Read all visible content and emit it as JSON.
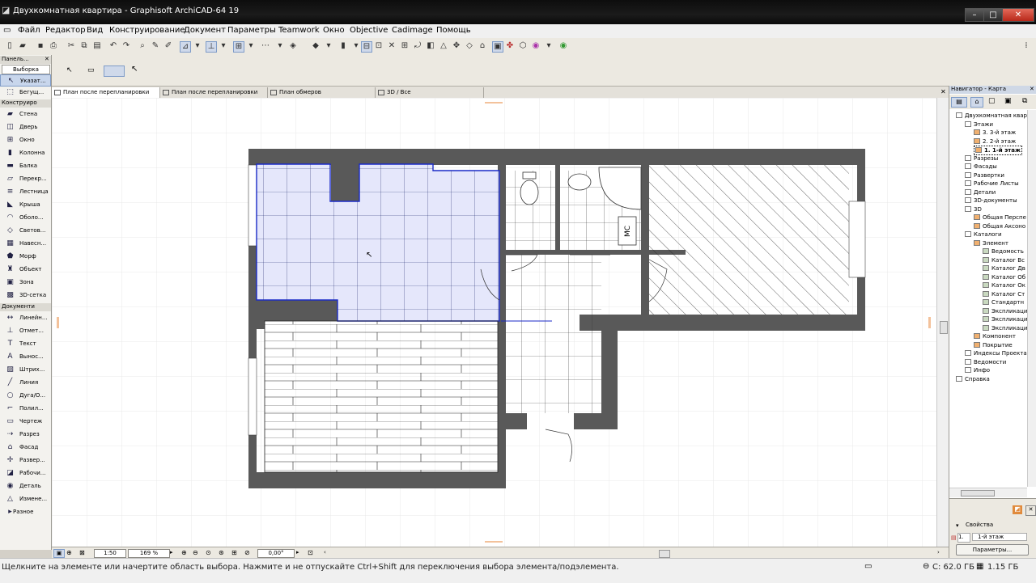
{
  "window": {
    "title": "Двухкомнатная квартира - Graphisoft ArchiCAD-64 19",
    "buttons": [
      "–",
      "□",
      "✕"
    ]
  },
  "menu": [
    "Файл",
    "Редактор",
    "Вид",
    "Конструирование",
    "Документ",
    "Параметры",
    "Teamwork",
    "Окно",
    "Objective",
    "Cadimage",
    "Помощь"
  ],
  "left_panel": {
    "header": "Панель...",
    "tab": "Выборка",
    "pointer": "Указат...",
    "marquee": "Бегущ...",
    "section_design": "Конструиро",
    "design_tools": [
      "Стена",
      "Дверь",
      "Окно",
      "Колонна",
      "Балка",
      "Перекр...",
      "Лестница",
      "Крыша",
      "Оболо...",
      "Светов...",
      "Навесн...",
      "Морф",
      "Объект",
      "Зона",
      "3D-сетка"
    ],
    "section_document": "Документи",
    "document_tools": [
      "Линейн...",
      "Отмет...",
      "Текст",
      "Вынос...",
      "Штрих...",
      "Линия",
      "Дуга/О...",
      "Полил...",
      "Чертеж",
      "Разрез",
      "Фасад",
      "Развер...",
      "Рабочи...",
      "Деталь",
      "Измене..."
    ],
    "section_misc": "Разное"
  },
  "tabs": [
    "План после перепланировки",
    "План после перепланировки",
    "План обмеров",
    "3D / Все"
  ],
  "drawing": {
    "label_wc": "МС"
  },
  "navigator": {
    "header": "Навигатор - Карта",
    "tree": [
      {
        "label": "Двухкомнатная кварти",
        "level": 0
      },
      {
        "label": "Этажи",
        "level": 1
      },
      {
        "label": "3. 3-й этаж",
        "level": 2
      },
      {
        "label": "2. 2-й этаж",
        "level": 2
      },
      {
        "label": "1. 1-й этаж",
        "level": 2,
        "selected": true
      },
      {
        "label": "Разрезы",
        "level": 1
      },
      {
        "label": "Фасады",
        "level": 1
      },
      {
        "label": "Развертки",
        "level": 1
      },
      {
        "label": "Рабочие Листы",
        "level": 1
      },
      {
        "label": "Детали",
        "level": 1
      },
      {
        "label": "3D-документы",
        "level": 1
      },
      {
        "label": "3D",
        "level": 1
      },
      {
        "label": "Общая Перспе",
        "level": 2
      },
      {
        "label": "Общая Аксоно",
        "level": 2
      },
      {
        "label": "Каталоги",
        "level": 1
      },
      {
        "label": "Элемент",
        "level": 2
      },
      {
        "label": "Ведомость",
        "level": 3
      },
      {
        "label": "Каталог Вс",
        "level": 3
      },
      {
        "label": "Каталог Дв",
        "level": 3
      },
      {
        "label": "Каталог Об",
        "level": 3
      },
      {
        "label": "Каталог Ок",
        "level": 3
      },
      {
        "label": "Каталог Ст",
        "level": 3
      },
      {
        "label": "Стандартн",
        "level": 3
      },
      {
        "label": "Экспликаци",
        "level": 3
      },
      {
        "label": "Экспликаци",
        "level": 3
      },
      {
        "label": "Экспликаци",
        "level": 3
      },
      {
        "label": "Компонент",
        "level": 2
      },
      {
        "label": "Покрытие",
        "level": 2
      },
      {
        "label": "Индексы Проекта",
        "level": 1
      },
      {
        "label": "Ведомости",
        "level": 1
      },
      {
        "label": "Инфо",
        "level": 1
      },
      {
        "label": "Справка",
        "level": 0
      }
    ],
    "properties_title": "Свойства",
    "properties_story_num": "1.",
    "properties_story": "1-й этаж",
    "params_button": "Параметры..."
  },
  "hbar": {
    "scale": "1:50",
    "zoom": "169 %",
    "angle": "0,00°"
  },
  "status": {
    "message": "Щелкните на элементе или начертите область выбора. Нажмите и не отпускайте Ctrl+Shift для переключения выбора элемента/подэлемента.",
    "disk_c": "C: 62.0 ГБ",
    "memory": "1.15 ГБ"
  }
}
